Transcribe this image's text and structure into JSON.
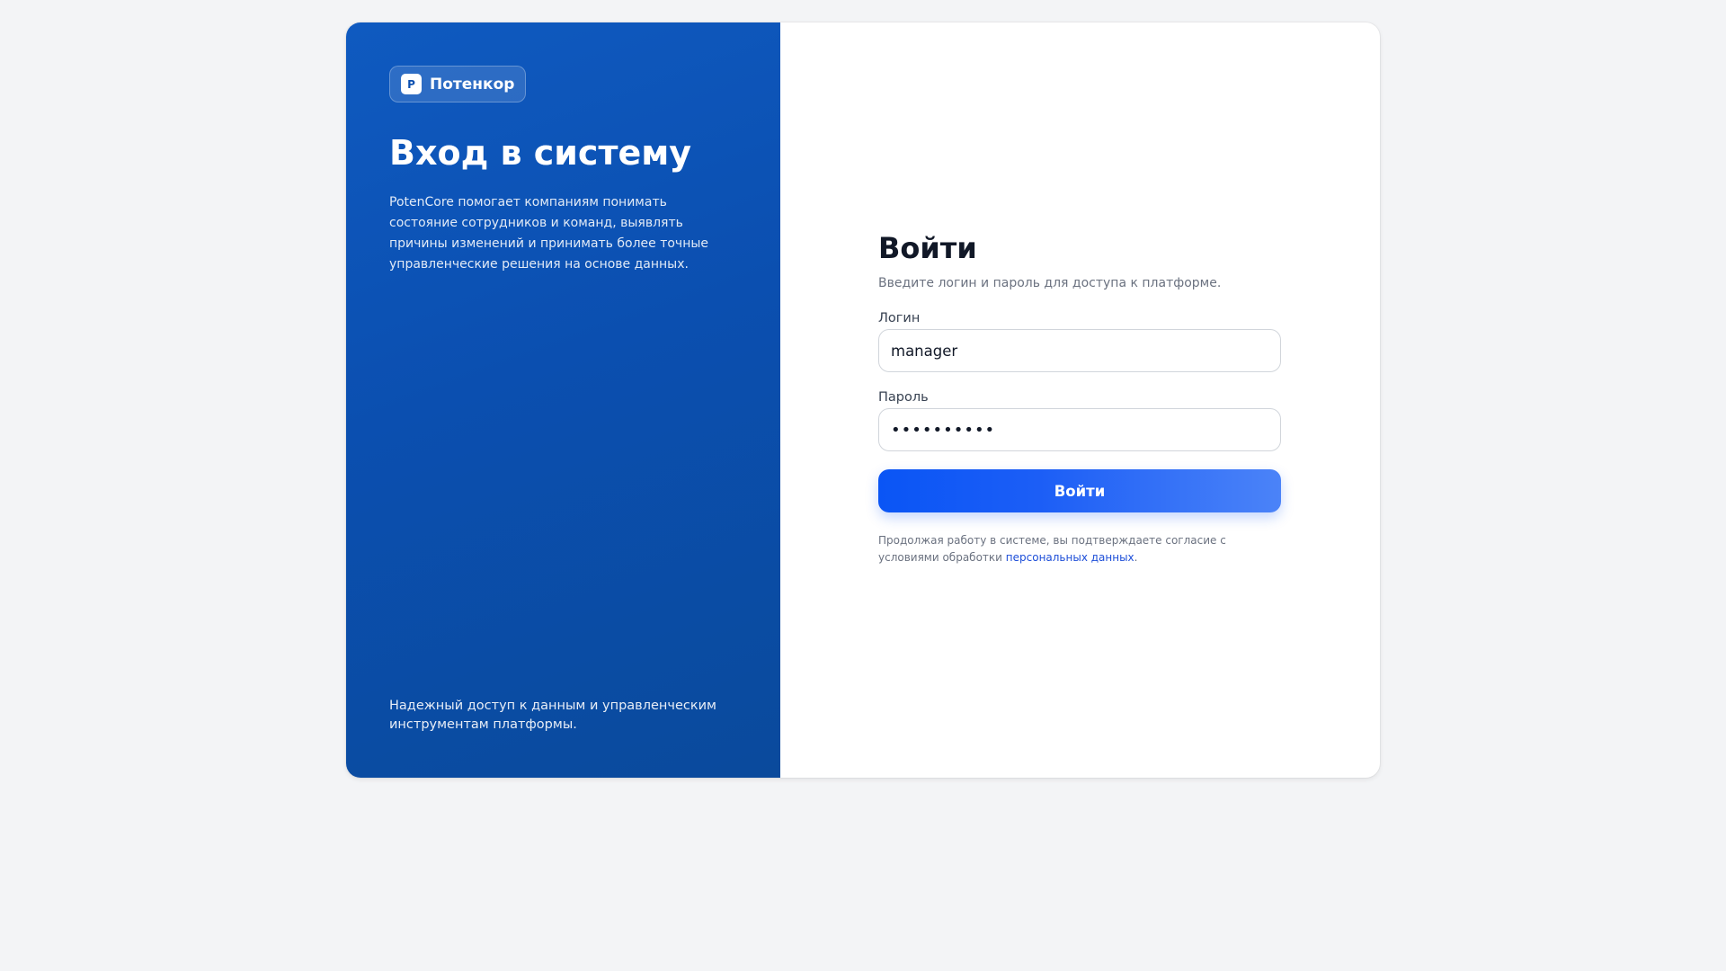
{
  "brand": {
    "mark": "P",
    "name": "Потенкор"
  },
  "left_panel": {
    "title": "Вход в систему",
    "description": "PotenCore помогает компаниям понимать состояние сотрудников и команд, выявлять причины изменений и принимать более точные управленческие решения на основе данных.",
    "footer": "Надежный доступ к данным и управленческим инструментам платформы."
  },
  "form": {
    "title": "Войти",
    "subtitle": "Введите логин и пароль для доступа к платформе.",
    "login_label": "Логин",
    "login_value": "manager",
    "password_label": "Пароль",
    "password_value": "••••••••••",
    "submit_label": "Войти",
    "consent_text": "Продолжая работу в системе, вы подтверждаете согласие с условиями обработки ",
    "consent_link": "персональных данных",
    "consent_end": "."
  },
  "colors": {
    "panel": "#0b4fb0",
    "accent": "#0a55f5",
    "link": "#1d4ed8",
    "background": "#f3f4f6"
  }
}
